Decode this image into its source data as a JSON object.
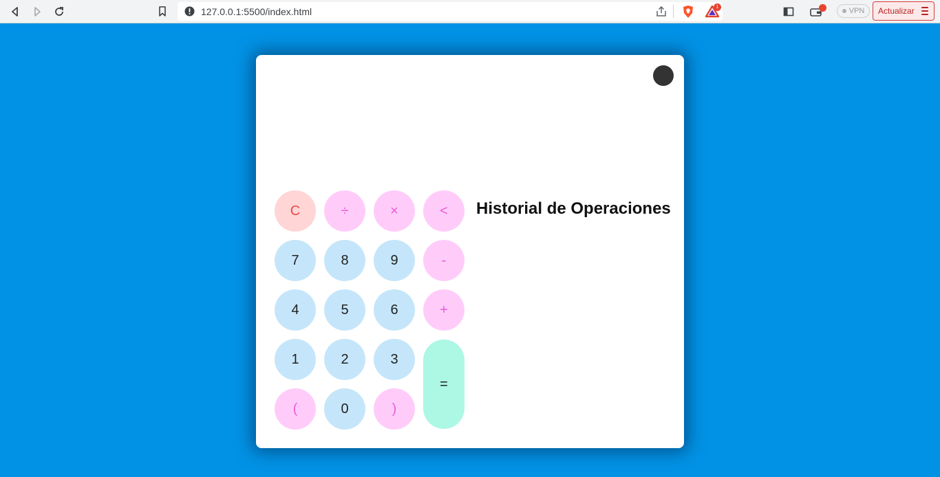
{
  "browser": {
    "url": "127.0.0.1:5500/index.html",
    "vpn_label": "VPN",
    "update_label": "Actualizar",
    "notification_count": "1"
  },
  "calculator": {
    "display_value": "",
    "history_title": "Historial de Operaciones",
    "keys": {
      "clear": "C",
      "divide": "÷",
      "multiply": "×",
      "backspace": "<",
      "seven": "7",
      "eight": "8",
      "nine": "9",
      "minus": "-",
      "four": "4",
      "five": "5",
      "six": "6",
      "plus": "+",
      "one": "1",
      "two": "2",
      "three": "3",
      "equals": "=",
      "open_paren": "(",
      "zero": "0",
      "close_paren": ")"
    }
  },
  "colors": {
    "page_background": "#0292e5",
    "number_key": "#c5e6fa",
    "operator_key": "#ffccfa",
    "clear_key": "#ffd5d5",
    "equals_key": "#adf7e5"
  },
  "icons": [
    "back-icon",
    "forward-icon",
    "reload-icon",
    "bookmark-icon",
    "info-icon",
    "share-icon",
    "brave-shield-icon",
    "brave-rewards-icon",
    "sidebar-icon",
    "wallet-icon",
    "menu-icon"
  ]
}
